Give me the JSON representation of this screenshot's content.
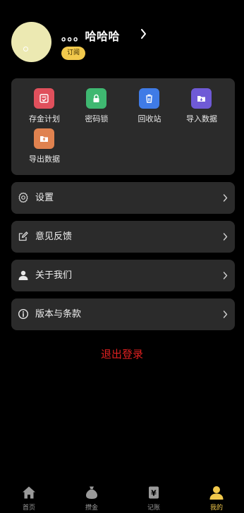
{
  "profile": {
    "username": "。。。哈哈哈",
    "subscribe_label": "订阅",
    "avatar_color": "#ece9b2"
  },
  "features": [
    {
      "label": "存金计划",
      "icon": "savings-plan-icon",
      "color": "#e0505c"
    },
    {
      "label": "密码锁",
      "icon": "lock-icon",
      "color": "#3fb871"
    },
    {
      "label": "回收站",
      "icon": "trash-icon",
      "color": "#3f7be6"
    },
    {
      "label": "导入数据",
      "icon": "folder-import-icon",
      "color": "#6f5ad6"
    },
    {
      "label": "导出数据",
      "icon": "folder-export-icon",
      "color": "#e0824f"
    }
  ],
  "menu": [
    {
      "label": "设置",
      "icon": "gear-icon"
    },
    {
      "label": "意见反馈",
      "icon": "edit-feedback-icon"
    },
    {
      "label": "关于我们",
      "icon": "person-icon"
    },
    {
      "label": "版本与条款",
      "icon": "info-icon"
    }
  ],
  "logout_label": "退出登录",
  "tabs": [
    {
      "label": "首页",
      "icon": "home-icon",
      "active": false
    },
    {
      "label": "攒金",
      "icon": "money-bag-icon",
      "active": false
    },
    {
      "label": "记账",
      "icon": "ledger-icon",
      "active": false
    },
    {
      "label": "我的",
      "icon": "user-icon",
      "active": true
    }
  ],
  "colors": {
    "accent": "#f2c94c",
    "danger": "#e02020",
    "card": "#2b2b2b",
    "background": "#000000"
  }
}
